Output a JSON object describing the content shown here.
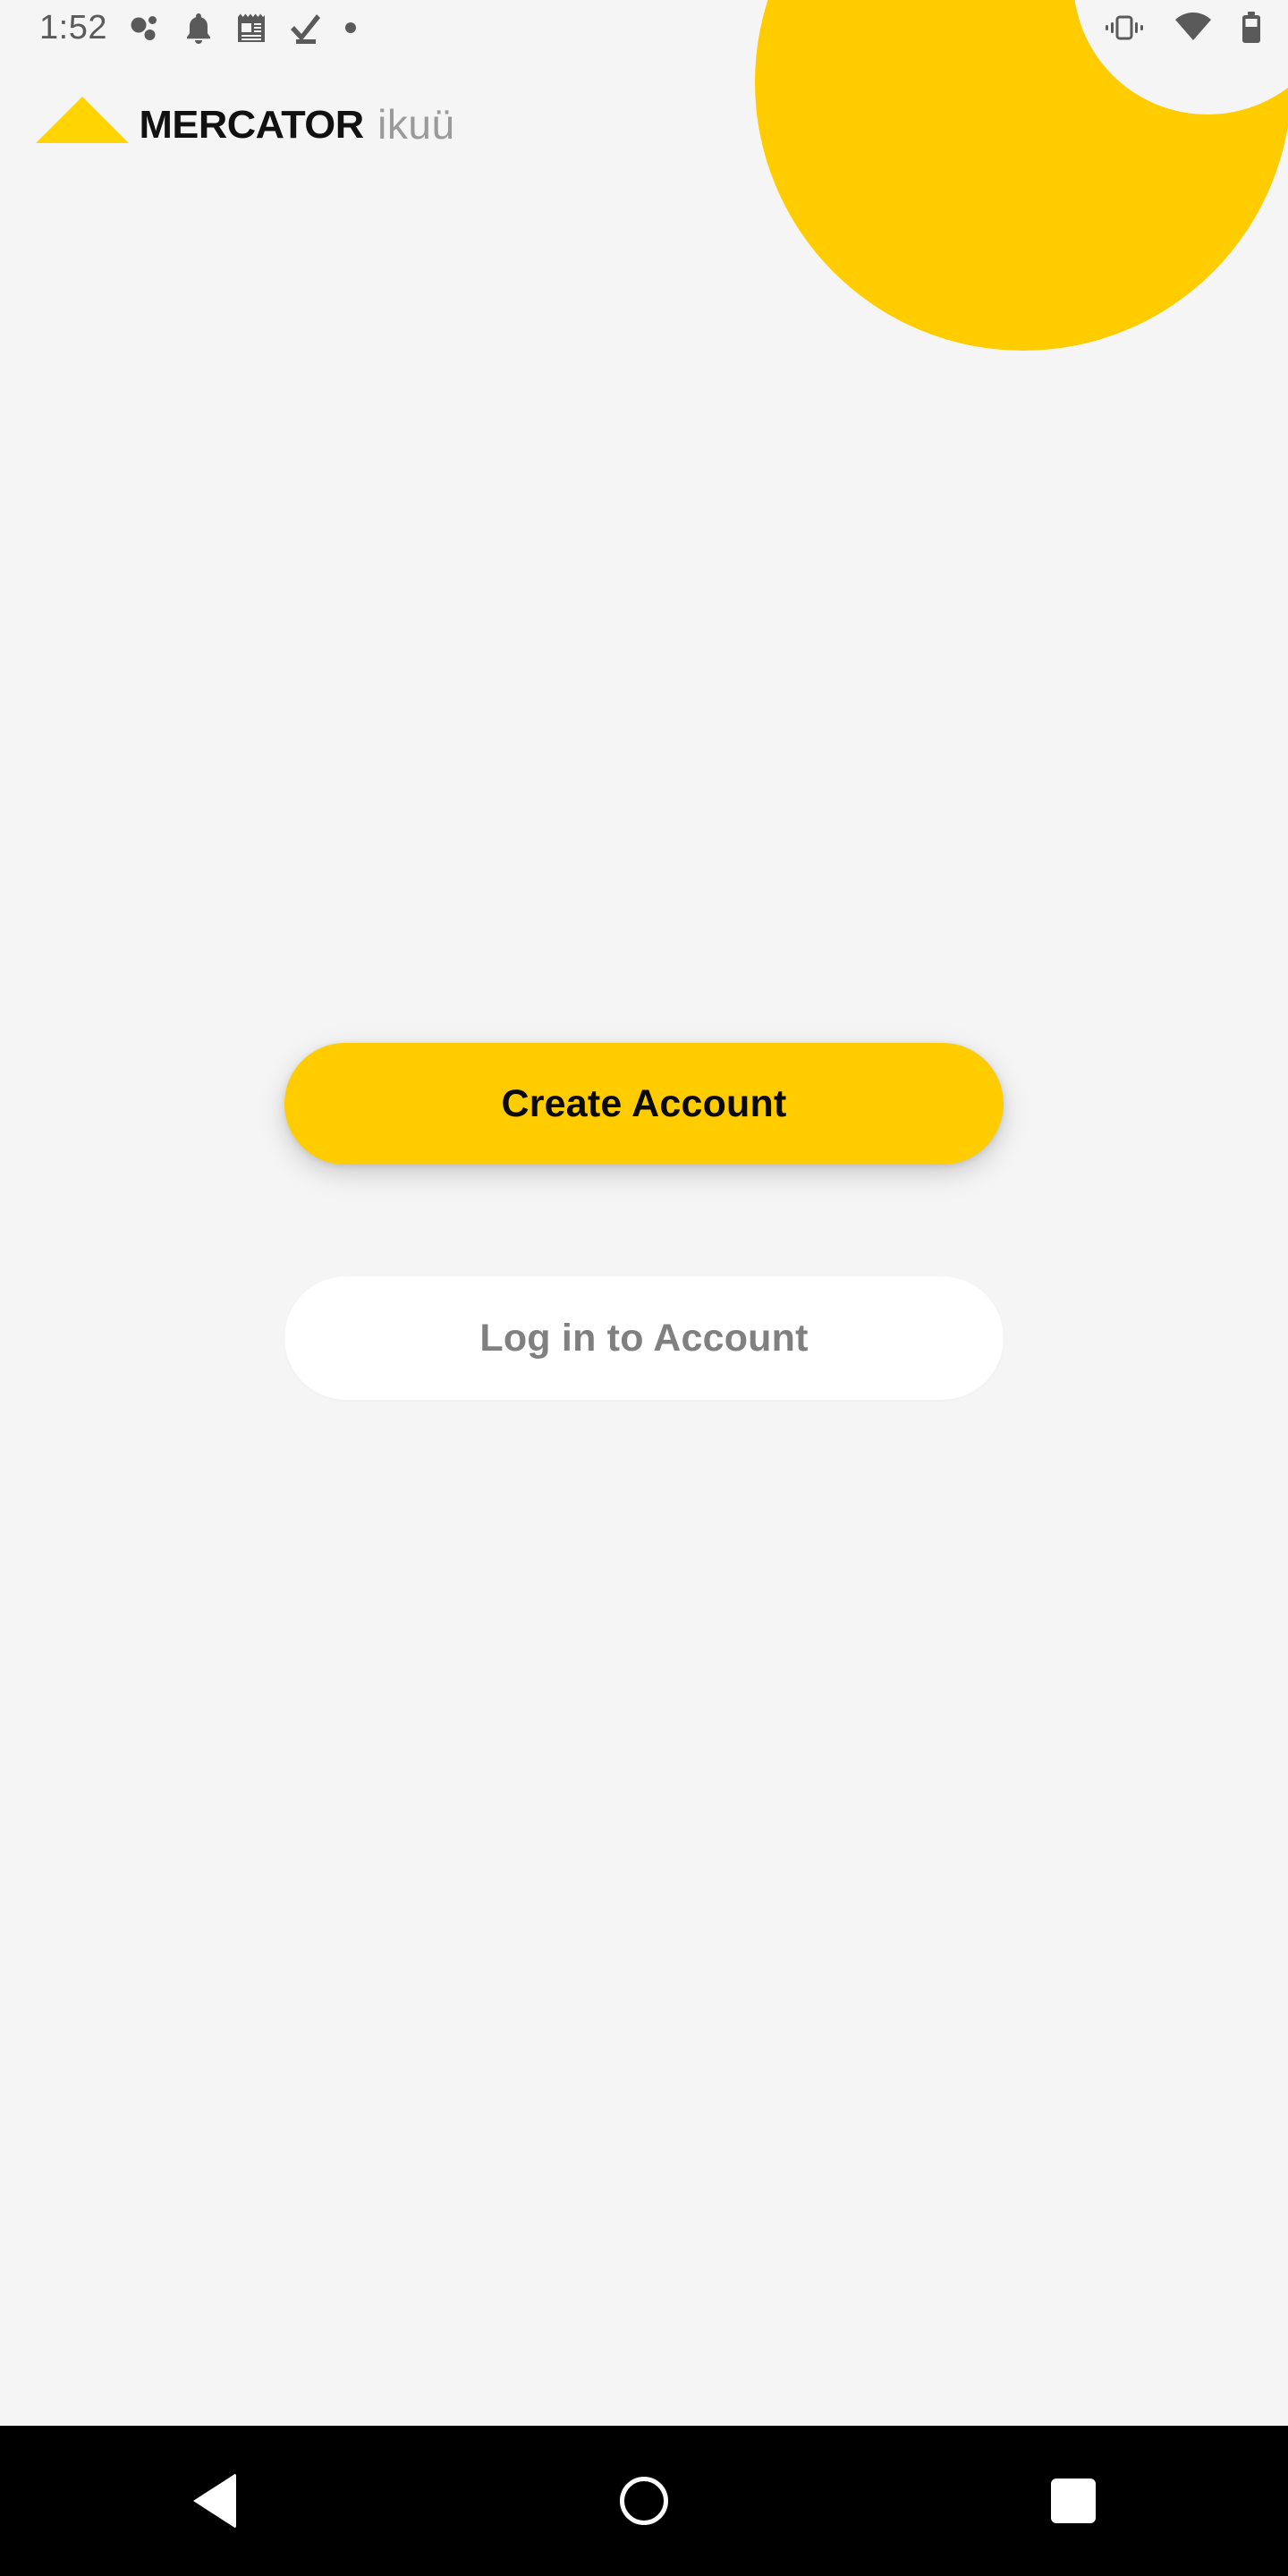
{
  "theme": {
    "brand_yellow": "#FFCC00",
    "background": "#f5f5f5",
    "primary_text": "#0a0a0a",
    "secondary_text": "#808080",
    "status_icon": "#5a5a5a",
    "navbar_background": "#000000"
  },
  "status_bar": {
    "time": "1:52",
    "left_icons": [
      {
        "name": "assistant-dots-icon"
      },
      {
        "name": "bell-icon"
      },
      {
        "name": "news-notepad-icon"
      },
      {
        "name": "tasks-check-icon"
      },
      {
        "name": "dot-icon"
      }
    ],
    "right_icons": [
      {
        "name": "vibrate-icon"
      },
      {
        "name": "wifi-icon"
      },
      {
        "name": "battery-icon"
      }
    ]
  },
  "brand": {
    "logo_shape": "triangle-icon",
    "name": "MERCATOR",
    "sub_name": "ikuü"
  },
  "actions": {
    "create_account_label": "Create Account",
    "login_label": "Log in to Account"
  },
  "navigation_bar": {
    "back_label": "Back",
    "home_label": "Home",
    "recents_label": "Recents"
  }
}
